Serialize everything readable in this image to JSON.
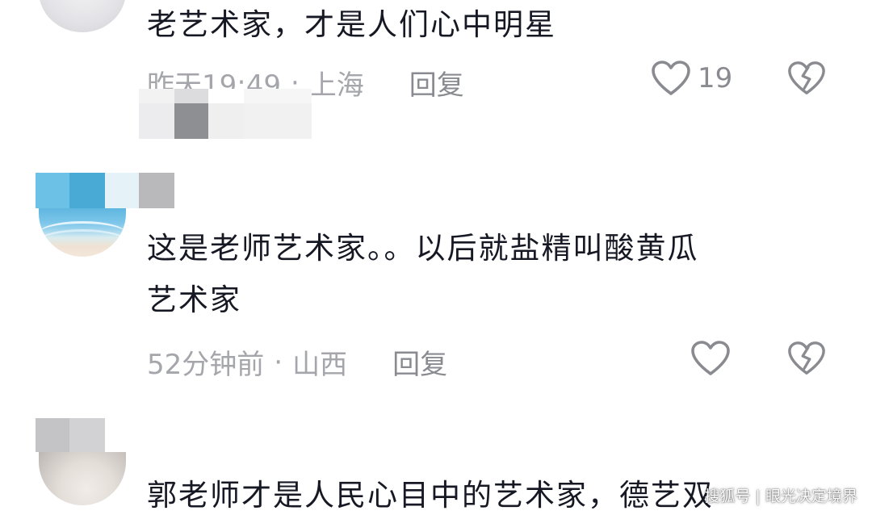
{
  "comments": [
    {
      "text_lines": [
        "老艺术家，才是人们心中明星"
      ],
      "time": "昨天19:49",
      "location": "上海",
      "reply_label": "回复",
      "like_count": "19"
    },
    {
      "text_lines": [
        "这是老师艺术家。。以后就盐精叫酸黄瓜",
        "艺术家"
      ],
      "time": "52分钟前",
      "location": "山西",
      "reply_label": "回复",
      "like_count": ""
    },
    {
      "text_lines": [
        "郭老师才是人民心目中的艺术家，德艺双"
      ]
    }
  ],
  "separator": "·",
  "icons": {
    "like": "heart-outline-icon",
    "dislike": "broken-heart-icon"
  },
  "watermark": "搜狐号 | 眼光决定境界",
  "colors": {
    "text": "#161823",
    "meta": "#a5a6ab",
    "icon_stroke": "#8a8b91"
  }
}
